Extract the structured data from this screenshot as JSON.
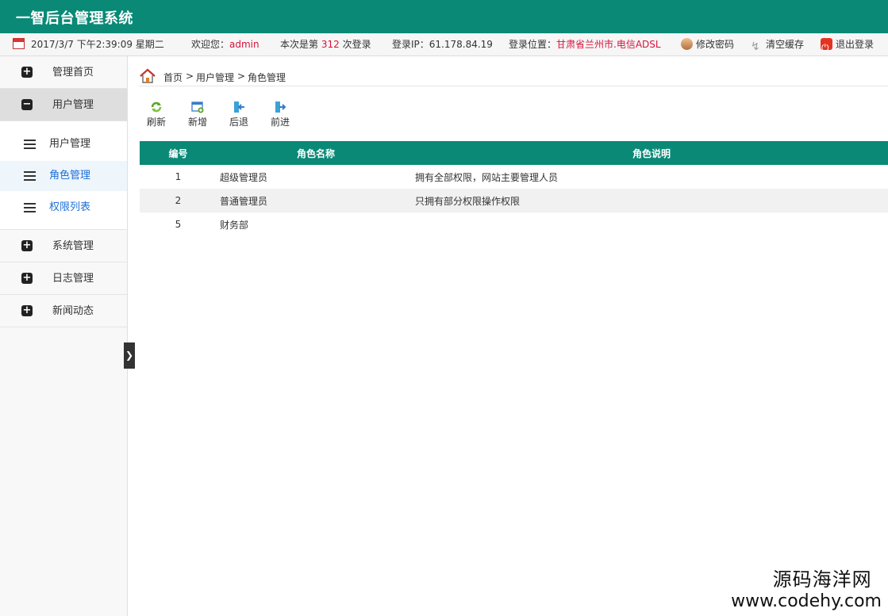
{
  "app": {
    "title": "一智后台管理系统"
  },
  "infobar": {
    "datetime": "2017/3/7 下午2:39:09 星期二",
    "welcome_prefix": "欢迎您：",
    "username": "admin",
    "login_count_prefix": "本次是第",
    "login_count": "312",
    "login_count_suffix": "次登录",
    "ip_label": "登录IP：61.178.84.19",
    "location_prefix": "登录位置：",
    "location": "甘肃省兰州市.电信ADSL",
    "change_password": "修改密码",
    "clear_cache": "清空缓存",
    "logout": "退出登录"
  },
  "sidebar": {
    "menus": [
      {
        "label": "管理首页",
        "sign": "+"
      },
      {
        "label": "用户管理",
        "sign": "−"
      },
      {
        "label": "系统管理",
        "sign": "+"
      },
      {
        "label": "日志管理",
        "sign": "+"
      },
      {
        "label": "新闻动态",
        "sign": "+"
      }
    ],
    "submenu": [
      {
        "label": "用户管理"
      },
      {
        "label": "角色管理"
      },
      {
        "label": "权限列表"
      }
    ],
    "toggle": "❯"
  },
  "breadcrumb": {
    "home": "首页",
    "sep1": ">",
    "level1": "用户管理",
    "sep2": ">",
    "current": "角色管理"
  },
  "toolbar": {
    "refresh": "刷新",
    "add": "新增",
    "back": "后退",
    "forward": "前进"
  },
  "table": {
    "columns": [
      "编号",
      "角色名称",
      "角色说明"
    ],
    "rows": [
      {
        "id": "1",
        "name": "超级管理员",
        "desc": "拥有全部权限，网站主要管理人员"
      },
      {
        "id": "2",
        "name": "普通管理员",
        "desc": "只拥有部分权限操作权限"
      },
      {
        "id": "5",
        "name": "财务部",
        "desc": ""
      }
    ]
  },
  "watermark": {
    "line1": "源码海洋网",
    "line2": "www.codehy.com"
  },
  "colors": {
    "brand": "#0a8977",
    "highlight": "#d6143c",
    "link": "#1e6fd8"
  }
}
